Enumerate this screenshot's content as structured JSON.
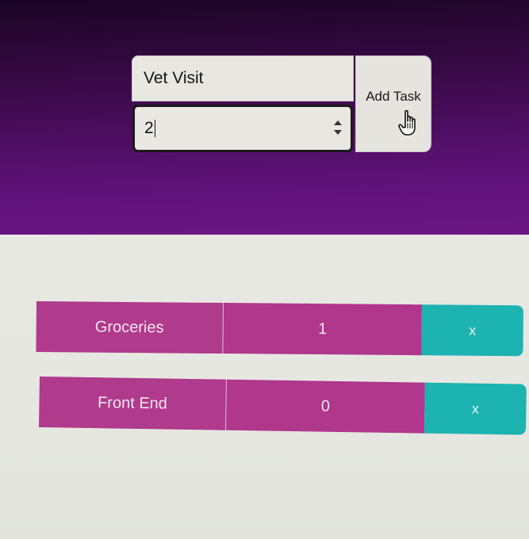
{
  "form": {
    "task_name_value": "Vet Visit",
    "task_count_value": "2",
    "add_button_label": "Add Task"
  },
  "tasks": [
    {
      "name": "Groceries",
      "count": "1",
      "delete_label": "x"
    },
    {
      "name": "Front End",
      "count": "0",
      "delete_label": "x"
    }
  ],
  "icons": {
    "cursor": "hand-pointer-icon",
    "stepper_up": "chevron-up-icon",
    "stepper_down": "chevron-down-icon"
  },
  "colors": {
    "header_gradient_top": "#1a0524",
    "header_gradient_bottom": "#6b1784",
    "task_background": "#b03a8c",
    "delete_button": "#1db3b0",
    "page_background": "#e8e8e2"
  }
}
